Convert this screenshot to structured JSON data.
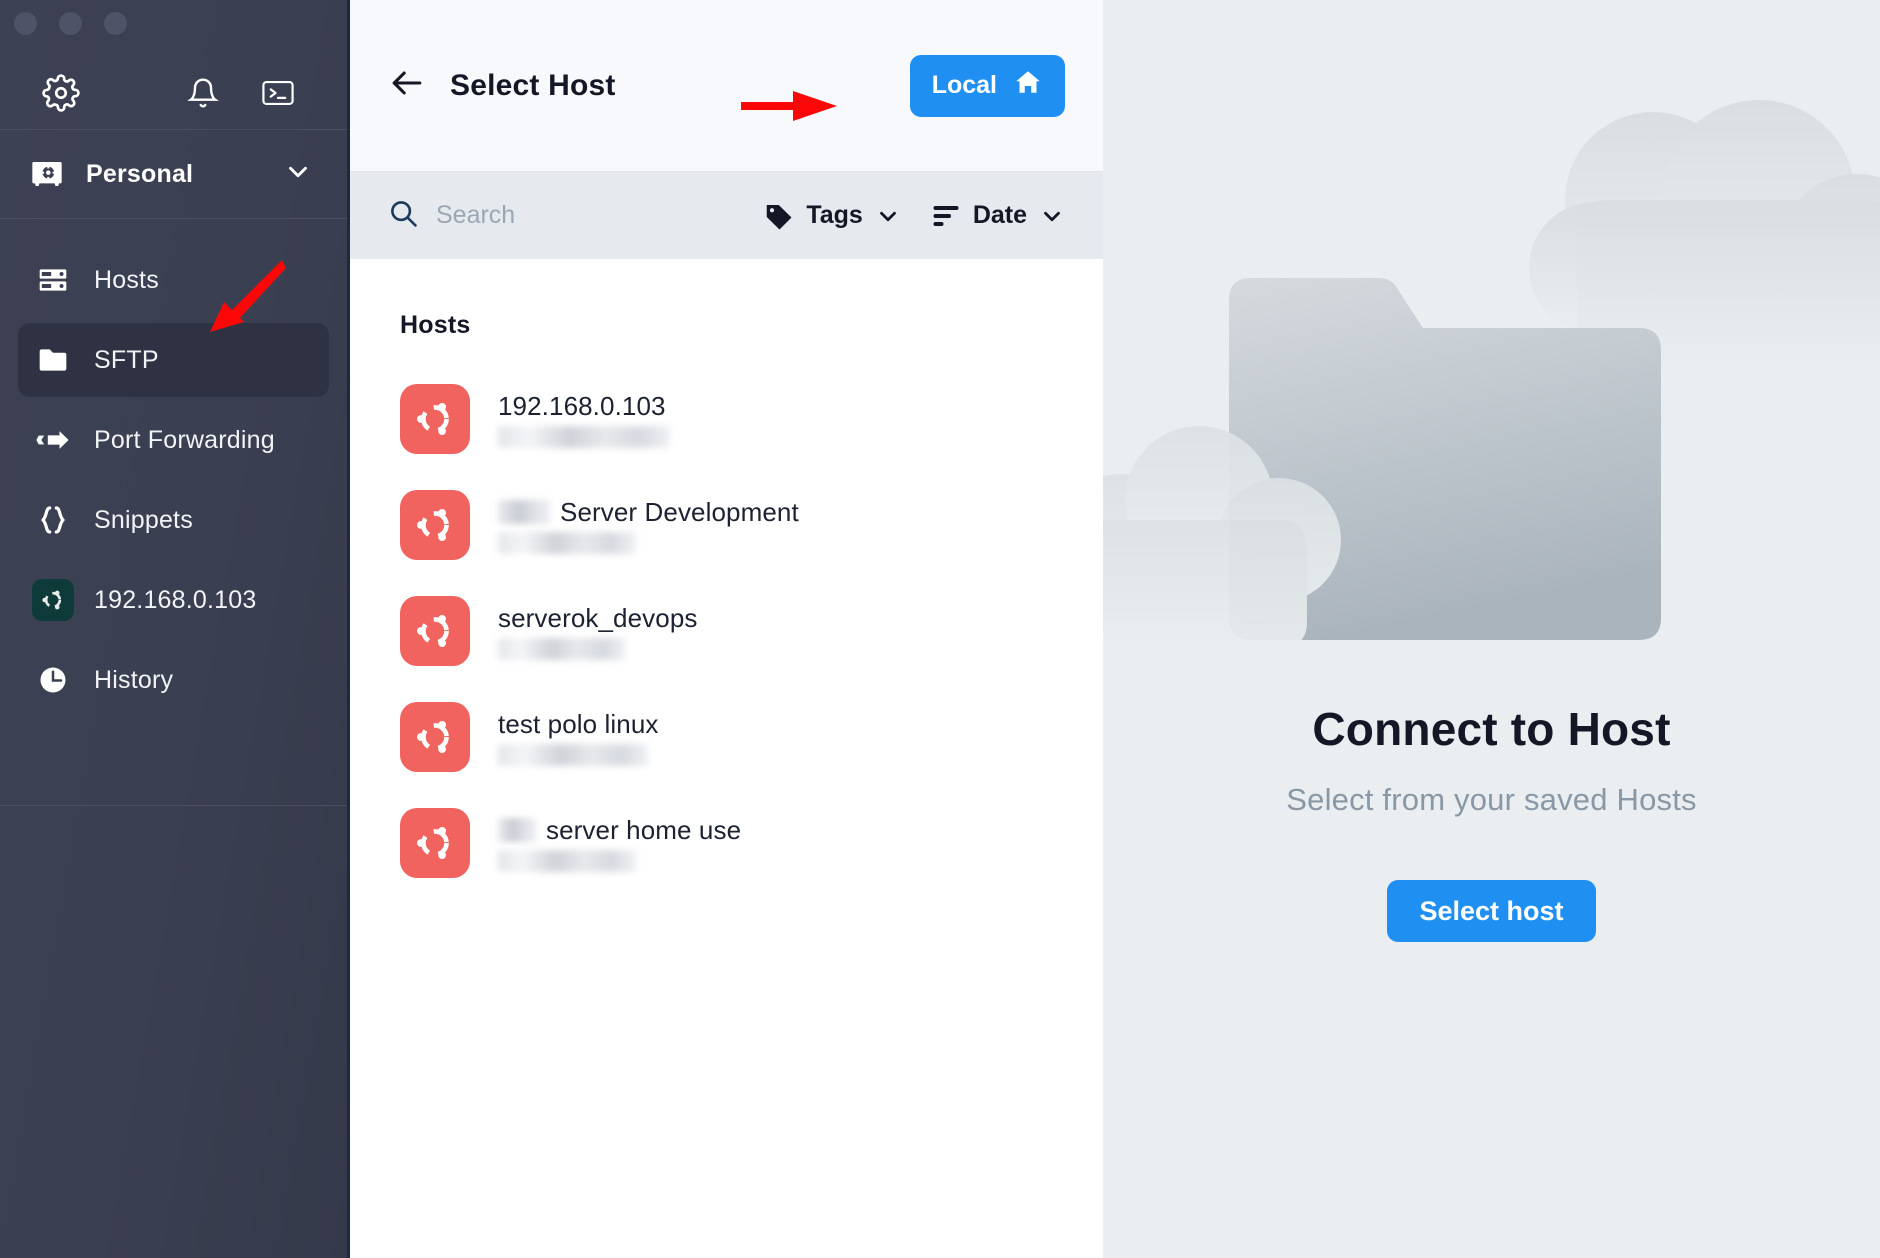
{
  "window": {
    "traffic_lights": [
      "close",
      "minimize",
      "maximize"
    ]
  },
  "sidebar": {
    "top_icons": [
      {
        "name": "gear-icon",
        "label": "Settings"
      },
      {
        "name": "bell-icon",
        "label": "Notifications"
      },
      {
        "name": "terminal-icon",
        "label": "Terminal"
      }
    ],
    "workspace": {
      "icon": "vault-icon",
      "label": "Personal",
      "chevron": "chevron-down-icon"
    },
    "items": [
      {
        "label": "Hosts",
        "icon": "server-icon",
        "active": false
      },
      {
        "label": "SFTP",
        "icon": "folder-icon",
        "active": true
      },
      {
        "label": "Port Forwarding",
        "icon": "arrows-icon",
        "active": false
      },
      {
        "label": "Snippets",
        "icon": "braces-icon",
        "active": false
      },
      {
        "label": "192.168.0.103",
        "icon": "ubuntu-icon",
        "active": false
      },
      {
        "label": "History",
        "icon": "clock-icon",
        "active": false
      }
    ]
  },
  "center": {
    "header": {
      "back_icon": "arrow-left-icon",
      "title": "Select Host",
      "local_button": {
        "label": "Local",
        "icon": "home-icon"
      }
    },
    "filters": {
      "search_icon": "search-icon",
      "search_value": "",
      "search_placeholder": "Search",
      "tags": {
        "label": "Tags",
        "icon": "tag-icon",
        "chevron": "chevron-down-icon"
      },
      "date": {
        "label": "Date",
        "icon": "sort-icon",
        "chevron": "chevron-down-icon"
      }
    },
    "list": {
      "section_title": "Hosts",
      "hosts": [
        {
          "name": "192.168.0.103",
          "icon": "ubuntu-icon",
          "name_prefix_redacted": false,
          "subtitle_redacted": true
        },
        {
          "name": "Server Development",
          "icon": "ubuntu-icon",
          "name_prefix_redacted": true,
          "subtitle_redacted": true
        },
        {
          "name": "serverok_devops",
          "icon": "ubuntu-icon",
          "name_prefix_redacted": false,
          "subtitle_redacted": true
        },
        {
          "name": "test polo linux",
          "icon": "ubuntu-icon",
          "name_prefix_redacted": false,
          "subtitle_redacted": true
        },
        {
          "name": "server home use",
          "icon": "ubuntu-icon",
          "name_prefix_redacted": true,
          "subtitle_redacted": true
        }
      ]
    }
  },
  "right_panel": {
    "illustration": "folder-clouds-illustration",
    "title": "Connect to Host",
    "subtitle": "Select from your saved Hosts",
    "button_label": "Select host"
  },
  "annotations": [
    {
      "name": "arrow-to-sftp",
      "target": "SFTP"
    },
    {
      "name": "arrow-to-local-button",
      "target": "Local"
    },
    {
      "name": "arrow-to-select-host-button",
      "target": "Select host"
    }
  ],
  "colors": {
    "sidebar_bg": "#3a3f51",
    "sidebar_active": "#2e3243",
    "accent_blue": "#1f90f2",
    "host_tile_red": "#f1635f",
    "ubuntu_tile_dark": "#0e3b3a",
    "right_panel_bg": "#eaeef0",
    "annotation_red": "#fb0707",
    "filter_bar_bg": "#e6eaee",
    "header_bg": "#f8f9fc"
  }
}
